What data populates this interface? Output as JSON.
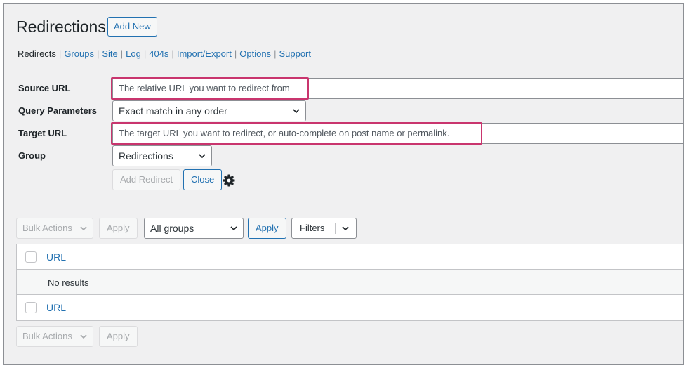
{
  "header": {
    "title": "Redirections",
    "add_new_label": "Add New"
  },
  "subnav": {
    "items": [
      {
        "label": "Redirects",
        "current": true
      },
      {
        "label": "Groups"
      },
      {
        "label": "Site"
      },
      {
        "label": "Log"
      },
      {
        "label": "404s"
      },
      {
        "label": "Import/Export"
      },
      {
        "label": "Options"
      },
      {
        "label": "Support"
      }
    ],
    "separator": "|"
  },
  "form": {
    "source_label": "Source URL",
    "source_placeholder": "The relative URL you want to redirect from",
    "query_label": "Query Parameters",
    "query_value": "Exact match in any order",
    "target_label": "Target URL",
    "target_placeholder": "The target URL you want to redirect, or auto-complete on post name or permalink.",
    "group_label": "Group",
    "group_value": "Redirections",
    "add_redirect_label": "Add Redirect",
    "close_label": "Close"
  },
  "toolbar_top": {
    "bulk_actions_label": "Bulk Actions",
    "apply_label": "Apply",
    "groups_filter_value": "All groups",
    "groups_apply_label": "Apply",
    "filters_label": "Filters"
  },
  "table": {
    "column_url": "URL",
    "empty_text": "No results",
    "footer_column_url": "URL"
  },
  "toolbar_bottom": {
    "bulk_actions_label": "Bulk Actions",
    "apply_label": "Apply"
  },
  "colors": {
    "accent": "#2271b1",
    "highlight": "#c9356e",
    "background": "#f0f0f1"
  }
}
